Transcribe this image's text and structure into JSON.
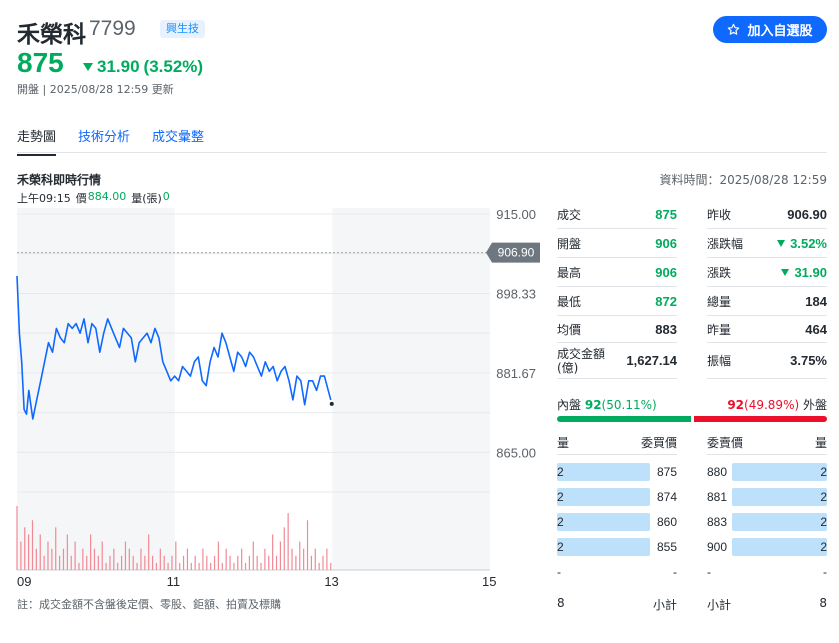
{
  "header": {
    "name": "禾榮科",
    "code": "7799",
    "market": "興生技",
    "price": "875",
    "change": "31.90",
    "change_pct": "(3.52%)",
    "status": "開盤 | 2025/08/28 12:59 更新",
    "watch_button": "加入自選股"
  },
  "tabs": [
    "走勢圖",
    "技術分析",
    "成交彙整"
  ],
  "chart": {
    "title": "禾榮科即時行情",
    "data_time": "資料時間：2025/08/28 12:59",
    "quote_time": "上午09:15",
    "quote_price_label": "價",
    "quote_price": "884.00",
    "quote_vol_label": "量(張)",
    "quote_vol": "0",
    "ref_label": "906.90",
    "note": "註：成交金額不含盤後定價、零股、鉅額、拍賣及標購"
  },
  "colors": {
    "up": "#eb0f29",
    "down": "#00ab5e",
    "line": "#0f69ff",
    "accent": "#0f69ff"
  },
  "chart_data": {
    "type": "line",
    "ylim": [
      855,
      915
    ],
    "yticks": [
      "915.00",
      "898.33",
      "881.67",
      "865.00"
    ],
    "ytick_values": [
      915,
      898.33,
      881.67,
      865
    ],
    "xticks": [
      "09",
      "11",
      "13",
      "15"
    ],
    "xtick_hours": [
      9,
      11,
      13,
      15
    ],
    "reference": 906.9,
    "x_hours": [
      9.0,
      9.03,
      9.06,
      9.09,
      9.12,
      9.15,
      9.2,
      9.25,
      9.3,
      9.35,
      9.4,
      9.45,
      9.5,
      9.55,
      9.6,
      9.65,
      9.7,
      9.75,
      9.8,
      9.85,
      9.9,
      9.95,
      10.0,
      10.05,
      10.1,
      10.15,
      10.2,
      10.25,
      10.3,
      10.35,
      10.4,
      10.45,
      10.5,
      10.55,
      10.6,
      10.65,
      10.7,
      10.75,
      10.8,
      10.85,
      10.9,
      10.95,
      11.0,
      11.05,
      11.1,
      11.15,
      11.2,
      11.25,
      11.3,
      11.35,
      11.4,
      11.45,
      11.5,
      11.55,
      11.6,
      11.65,
      11.7,
      11.75,
      11.8,
      11.85,
      11.9,
      11.95,
      12.0,
      12.05,
      12.1,
      12.15,
      12.2,
      12.25,
      12.3,
      12.35,
      12.4,
      12.45,
      12.5,
      12.55,
      12.6,
      12.65,
      12.7,
      12.75,
      12.8,
      12.85,
      12.9,
      12.98
    ],
    "prices": [
      902,
      890,
      884,
      874,
      873,
      878,
      872,
      876,
      880,
      884,
      888,
      886,
      891,
      889,
      888,
      892,
      891,
      892,
      890,
      893,
      888,
      892,
      891,
      886,
      890,
      893,
      891,
      889,
      887,
      891,
      890,
      889,
      884,
      888,
      889,
      890,
      888,
      891,
      889,
      884,
      882,
      880,
      881,
      880,
      883,
      882,
      881,
      884,
      885,
      880,
      879,
      884,
      887,
      885,
      890,
      888,
      885,
      882,
      886,
      885,
      883,
      886,
      885,
      883,
      881,
      884,
      882,
      883,
      880,
      882,
      883,
      880,
      876,
      881,
      880,
      875,
      880,
      880,
      878,
      881,
      881,
      876
    ],
    "volume_series": [
      {
        "name": "buy",
        "values": [
          9,
          4,
          6,
          5,
          7,
          3,
          5,
          2,
          4,
          3,
          6,
          2,
          3,
          5,
          2,
          4,
          1,
          3,
          2,
          5,
          3,
          2,
          4,
          1,
          2,
          3,
          1,
          2,
          4,
          3,
          2,
          1,
          3,
          2,
          5,
          2,
          1,
          3,
          2,
          1,
          2,
          4,
          1,
          2,
          3,
          1,
          2,
          1,
          3,
          2,
          1,
          2,
          4,
          1,
          3,
          2,
          1,
          2,
          3,
          1,
          2,
          4,
          2,
          1,
          3,
          2,
          5,
          2,
          4,
          6,
          8,
          3,
          2,
          4,
          3,
          7,
          2,
          3,
          1,
          2,
          3,
          1
        ]
      }
    ]
  },
  "stats": [
    {
      "label": "成交",
      "value": "875",
      "tone": "down"
    },
    {
      "label": "昨收",
      "value": "906.90",
      "tone": "plain"
    },
    {
      "label": "開盤",
      "value": "906",
      "tone": "plain_g"
    },
    {
      "label": "漲跌幅",
      "value": "3.52%",
      "tone": "down_tri"
    },
    {
      "label": "最高",
      "value": "906",
      "tone": "plain_g"
    },
    {
      "label": "漲跌",
      "value": "31.90",
      "tone": "down_tri"
    },
    {
      "label": "最低",
      "value": "872",
      "tone": "down"
    },
    {
      "label": "總量",
      "value": "184",
      "tone": "plain"
    },
    {
      "label": "均價",
      "value": "883",
      "tone": "plain"
    },
    {
      "label": "昨量",
      "value": "464",
      "tone": "plain"
    },
    {
      "label": "成交金額(億)",
      "value": "1,627.14",
      "tone": "plain"
    },
    {
      "label": "振幅",
      "value": "3.75%",
      "tone": "plain"
    }
  ],
  "inout": {
    "in_label": "內盤",
    "in_value": "92",
    "in_pct": "(50.11%)",
    "out_value": "92",
    "out_pct": "(49.89%)",
    "out_label": "外盤",
    "in_fraction": 0.5011
  },
  "orderbook": {
    "bid_head_qty": "量",
    "bid_head_price": "委買價",
    "ask_head_price": "委賣價",
    "ask_head_qty": "量",
    "bids": [
      {
        "qty": "2",
        "price": "875"
      },
      {
        "qty": "2",
        "price": "874"
      },
      {
        "qty": "2",
        "price": "860"
      },
      {
        "qty": "2",
        "price": "855"
      },
      {
        "qty": "-",
        "price": "-"
      }
    ],
    "asks": [
      {
        "price": "880",
        "qty": "2"
      },
      {
        "price": "881",
        "qty": "2"
      },
      {
        "price": "883",
        "qty": "2"
      },
      {
        "price": "900",
        "qty": "2"
      },
      {
        "price": "-",
        "qty": "-"
      }
    ],
    "bid_total_qty": "8",
    "bid_total_label": "小計",
    "ask_total_label": "小計",
    "ask_total_qty": "8"
  }
}
